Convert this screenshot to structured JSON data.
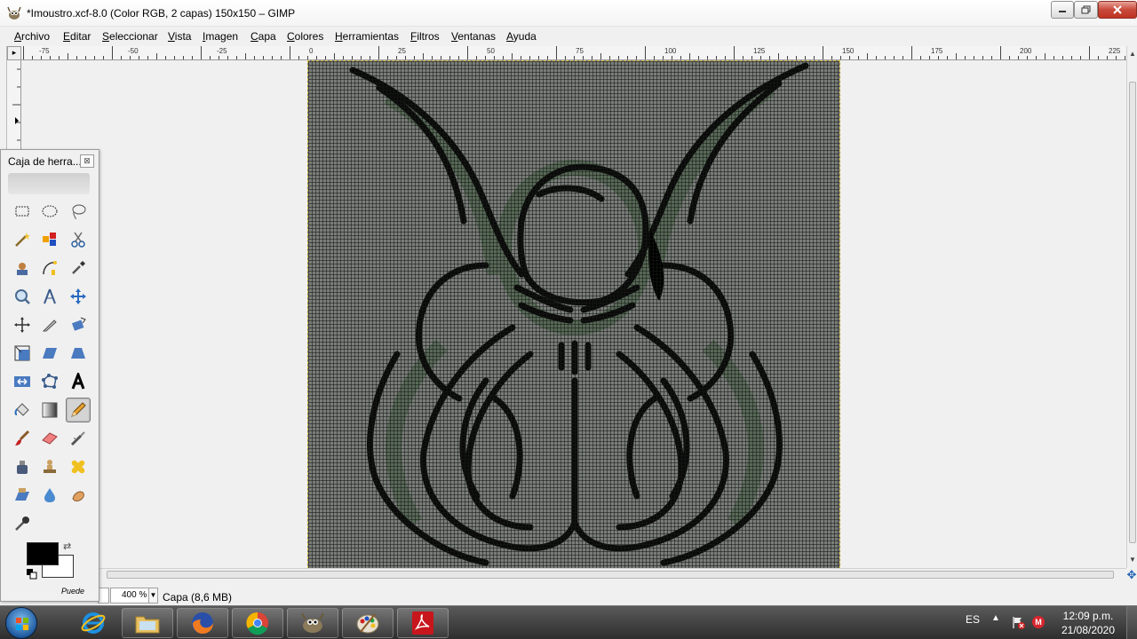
{
  "window": {
    "title": "*Imoustro.xcf-8.0 (Color RGB, 2 capas) 150x150 – GIMP"
  },
  "menu": [
    "Archivo",
    "Editar",
    "Seleccionar",
    "Vista",
    "Imagen",
    "Capa",
    "Colores",
    "Herramientas",
    "Filtros",
    "Ventanas",
    "Ayuda"
  ],
  "ruler": {
    "labels": [
      "-75",
      "-50",
      "-25",
      "0",
      "25",
      "50",
      "75",
      "100",
      "125",
      "150",
      "175",
      "200",
      "225"
    ]
  },
  "status": {
    "zoom": "400 %",
    "layer_info": "Capa (8,6 MB)"
  },
  "toolbox": {
    "title": "Caja de herra...",
    "hint": "Puede",
    "fg_color": "#000000",
    "bg_color": "#ffffff",
    "tools": [
      "rect-select",
      "ellipse-select",
      "free-select",
      "fuzzy-select",
      "select-by-color",
      "scissors-select",
      "foreground-select",
      "paths",
      "color-picker",
      "zoom",
      "measure",
      "move",
      "align",
      "crop",
      "rotate",
      "scale",
      "shear",
      "perspective",
      "flip",
      "cage-transform",
      "text",
      "bucket-fill",
      "blend",
      "pencil",
      "paintbrush",
      "eraser",
      "airbrush",
      "ink",
      "clone",
      "heal",
      "perspective-clone",
      "blur",
      "smudge",
      "dodge-burn"
    ],
    "active_tool": "pencil"
  },
  "taskbar": {
    "apps": [
      "internet-explorer",
      "file-explorer",
      "firefox",
      "chrome",
      "gimp",
      "paint",
      "acrobat-reader"
    ],
    "language": "ES",
    "time": "12:09 p.m.",
    "date": "21/08/2020"
  }
}
